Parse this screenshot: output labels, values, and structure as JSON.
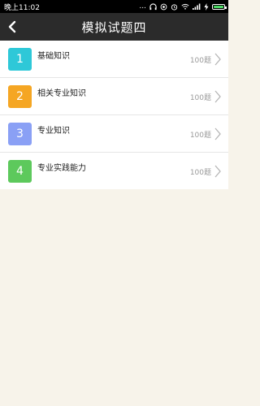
{
  "status_bar": {
    "time": "晚上11:02",
    "signal_label": "...",
    "colors": {
      "battery": "#4cd964"
    }
  },
  "header": {
    "title": "模拟试题四",
    "back_icon": "back-arrow-icon"
  },
  "list": {
    "items": [
      {
        "number": "1",
        "label": "基础知识",
        "count": "100题",
        "color": "#2ec8d8"
      },
      {
        "number": "2",
        "label": "相关专业知识",
        "count": "100题",
        "color": "#f5a623"
      },
      {
        "number": "3",
        "label": "专业知识",
        "count": "100题",
        "color": "#8aa0f5"
      },
      {
        "number": "4",
        "label": "专业实践能力",
        "count": "100题",
        "color": "#5dc95c"
      }
    ]
  }
}
